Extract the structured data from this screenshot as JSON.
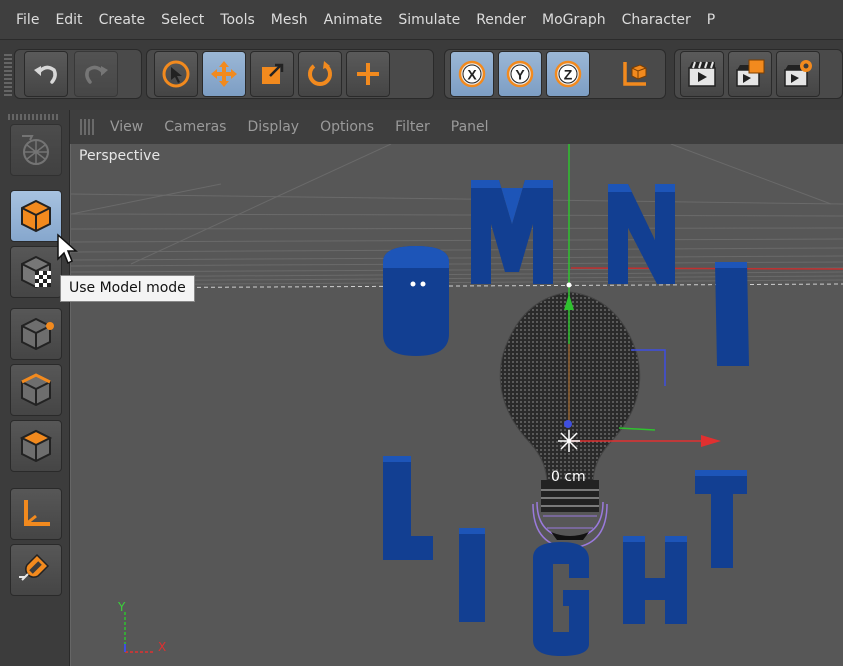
{
  "menu": [
    "File",
    "Edit",
    "Create",
    "Select",
    "Tools",
    "Mesh",
    "Animate",
    "Simulate",
    "Render",
    "MoGraph",
    "Character",
    "P"
  ],
  "toolbar": {
    "icons": [
      "undo-icon",
      "redo-icon",
      "live-selection-icon",
      "move-icon",
      "scale-icon",
      "rotate-icon",
      "add-icon",
      "x-axis-lock-icon",
      "y-axis-lock-icon",
      "z-axis-lock-icon",
      "coordinate-system-icon",
      "render-view-icon",
      "render-picture-queue-icon",
      "render-settings-icon"
    ],
    "axis_labels": [
      "X",
      "Y",
      "Z"
    ]
  },
  "palette": {
    "icons": [
      "make-editable-icon",
      "model-mode-icon",
      "texture-mode-icon",
      "points-mode-icon",
      "edges-mode-icon",
      "polygons-mode-icon",
      "axis-mode-icon",
      "snap-magnet-icon"
    ],
    "active": "model-mode-icon"
  },
  "viewport_menu": [
    "View",
    "Cameras",
    "Display",
    "Options",
    "Filter",
    "Panel"
  ],
  "viewport": {
    "camera_label": "Perspective",
    "distance_readout": "0 cm",
    "axis_y": "Y",
    "axis_x": "X"
  },
  "tooltip": "Use Model mode",
  "colors": {
    "active_button": "#8eaed2",
    "letters": "#0b3a8c",
    "axis_x": "#e03030",
    "axis_y": "#3ad23a",
    "highlight_orange": "#f28a1e"
  }
}
